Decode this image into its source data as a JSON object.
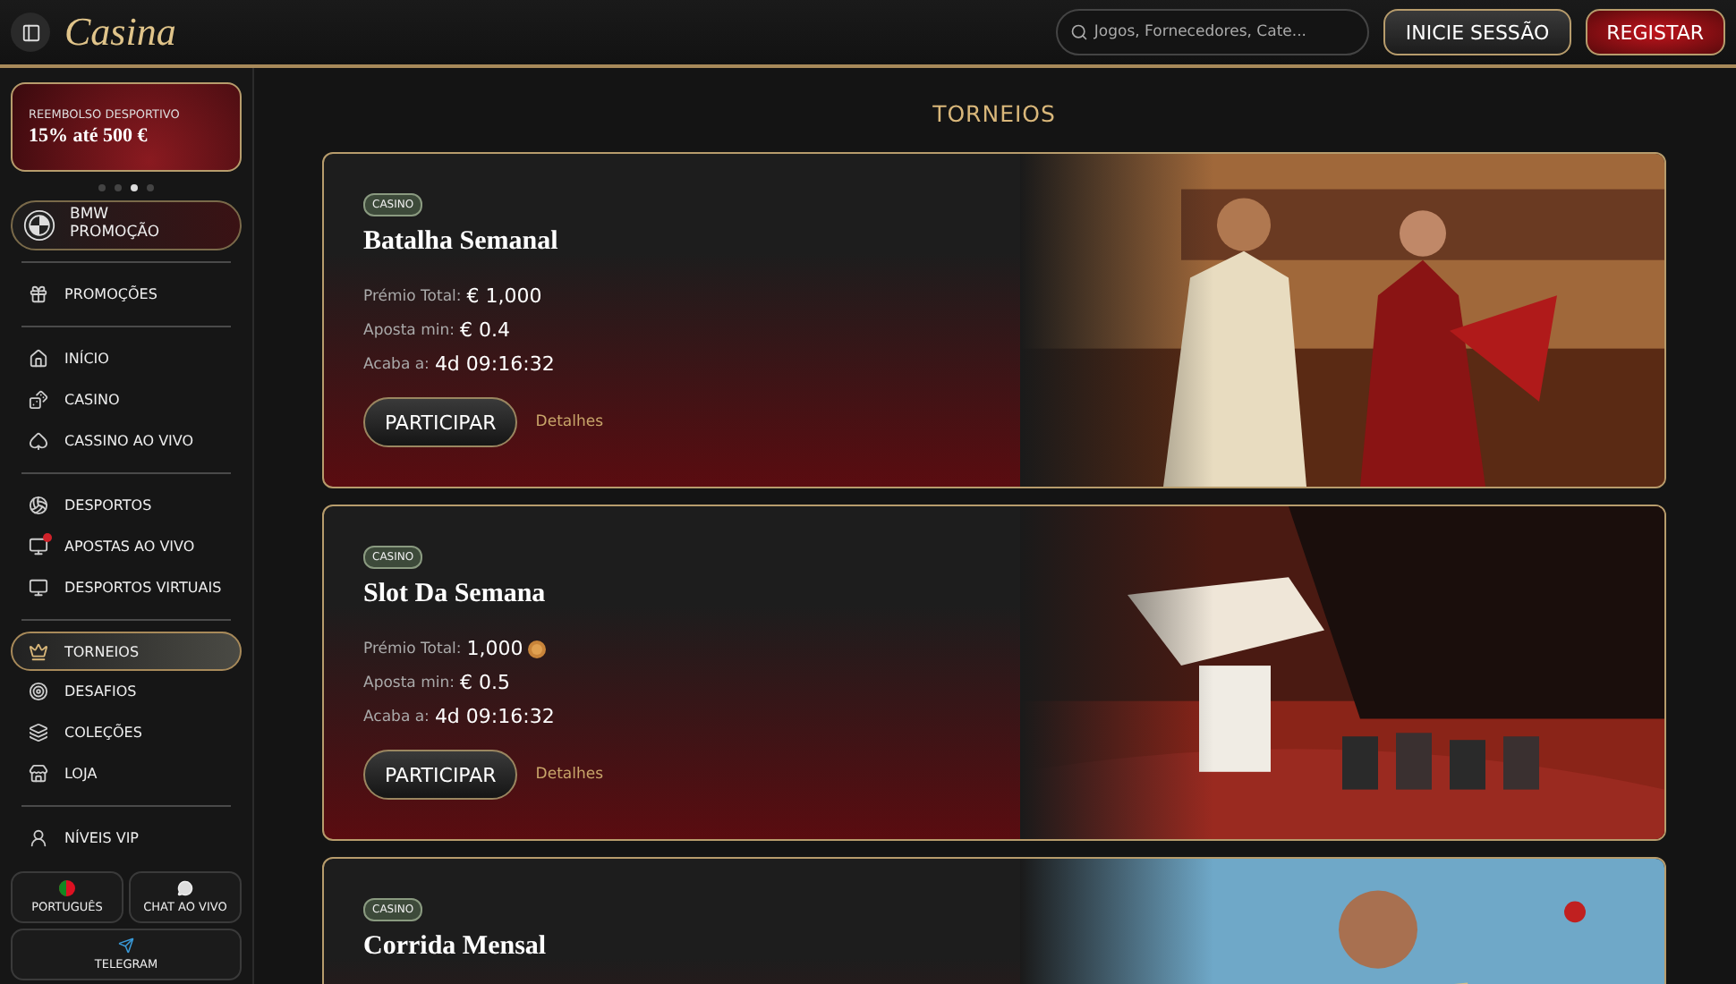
{
  "header": {
    "logo": "Casina",
    "search": {
      "placeholder": "Jogos, Fornecedores, Cate..."
    },
    "login_button": "INICIE SESSÃO",
    "register_button": "REGISTAR"
  },
  "sidebar": {
    "promo_banner": {
      "label": "REEMBOLSO DESPORTIVO",
      "offer": "15% até 500 €"
    },
    "promo_dots": [
      {
        "selected": false
      },
      {
        "selected": false
      },
      {
        "selected": true
      },
      {
        "selected": false
      }
    ],
    "bmw_button": {
      "line_1": "BMW",
      "line_2": "PROMOÇÃO"
    },
    "sections": [
      [
        {
          "label": "PROMOÇÕES",
          "selected": false
        }
      ],
      [
        {
          "label": "INÍCIO",
          "selected": false
        },
        {
          "label": "CASINO",
          "selected": false
        },
        {
          "label": "CASSINO AO VIVO",
          "selected": false
        }
      ],
      [
        {
          "label": "DESPORTOS",
          "selected": false
        },
        {
          "label": "APOSTAS AO VIVO",
          "selected": false
        },
        {
          "label": "DESPORTOS VIRTUAIS",
          "selected": false
        }
      ],
      [
        {
          "label": "TORNEIOS",
          "selected": true
        },
        {
          "label": "DESAFIOS",
          "selected": false
        },
        {
          "label": "COLEÇÕES",
          "selected": false
        },
        {
          "label": "LOJA",
          "selected": false
        }
      ],
      [
        {
          "label": "NÍVEIS VIP",
          "selected": false
        }
      ]
    ],
    "bottom_buttons": [
      "PORTUGUÊS",
      "CHAT AO VIVO",
      "TELEGRAM"
    ]
  },
  "main": {
    "title": "TORNEIOS",
    "tournaments": [
      {
        "tag": "CASINO",
        "title": "Batalha Semanal",
        "prize_label": "Prémio Total:",
        "prize": "€ 1,000",
        "prize_coin": false,
        "min_bet_label": "Aposta min:",
        "min_bet": "€ 0.4",
        "ends_label": "Acaba a:",
        "ends": "4d 09:16:32",
        "button": "PARTICIPAR",
        "details": "Detalhes"
      },
      {
        "tag": "CASINO",
        "title": "Slot Da Semana",
        "prize_label": "Prémio Total:",
        "prize": "1,000",
        "prize_coin": true,
        "min_bet_label": "Aposta min:",
        "min_bet": "€ 0.5",
        "ends_label": "Acaba a:",
        "ends": "4d 09:16:32",
        "button": "PARTICIPAR",
        "details": "Detalhes"
      },
      {
        "tag": "CASINO",
        "title": "Corrida Mensal"
      }
    ]
  }
}
